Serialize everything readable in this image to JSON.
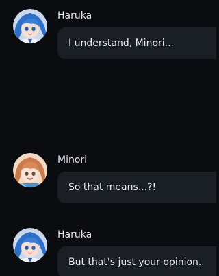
{
  "theme": {
    "background": "#0b0c10",
    "bubble": "#1a1e25",
    "text": "#e8ebef",
    "name_text": "#e3e6ea"
  },
  "messages": [
    {
      "sender": "Haruka",
      "avatar": "haruka-avatar",
      "text": "I understand, Minori..."
    },
    {
      "sender": "Minori",
      "avatar": "minori-avatar",
      "text": "So that means...?!"
    },
    {
      "sender": "Haruka",
      "avatar": "haruka-avatar",
      "text": "But that's just your opinion."
    }
  ]
}
